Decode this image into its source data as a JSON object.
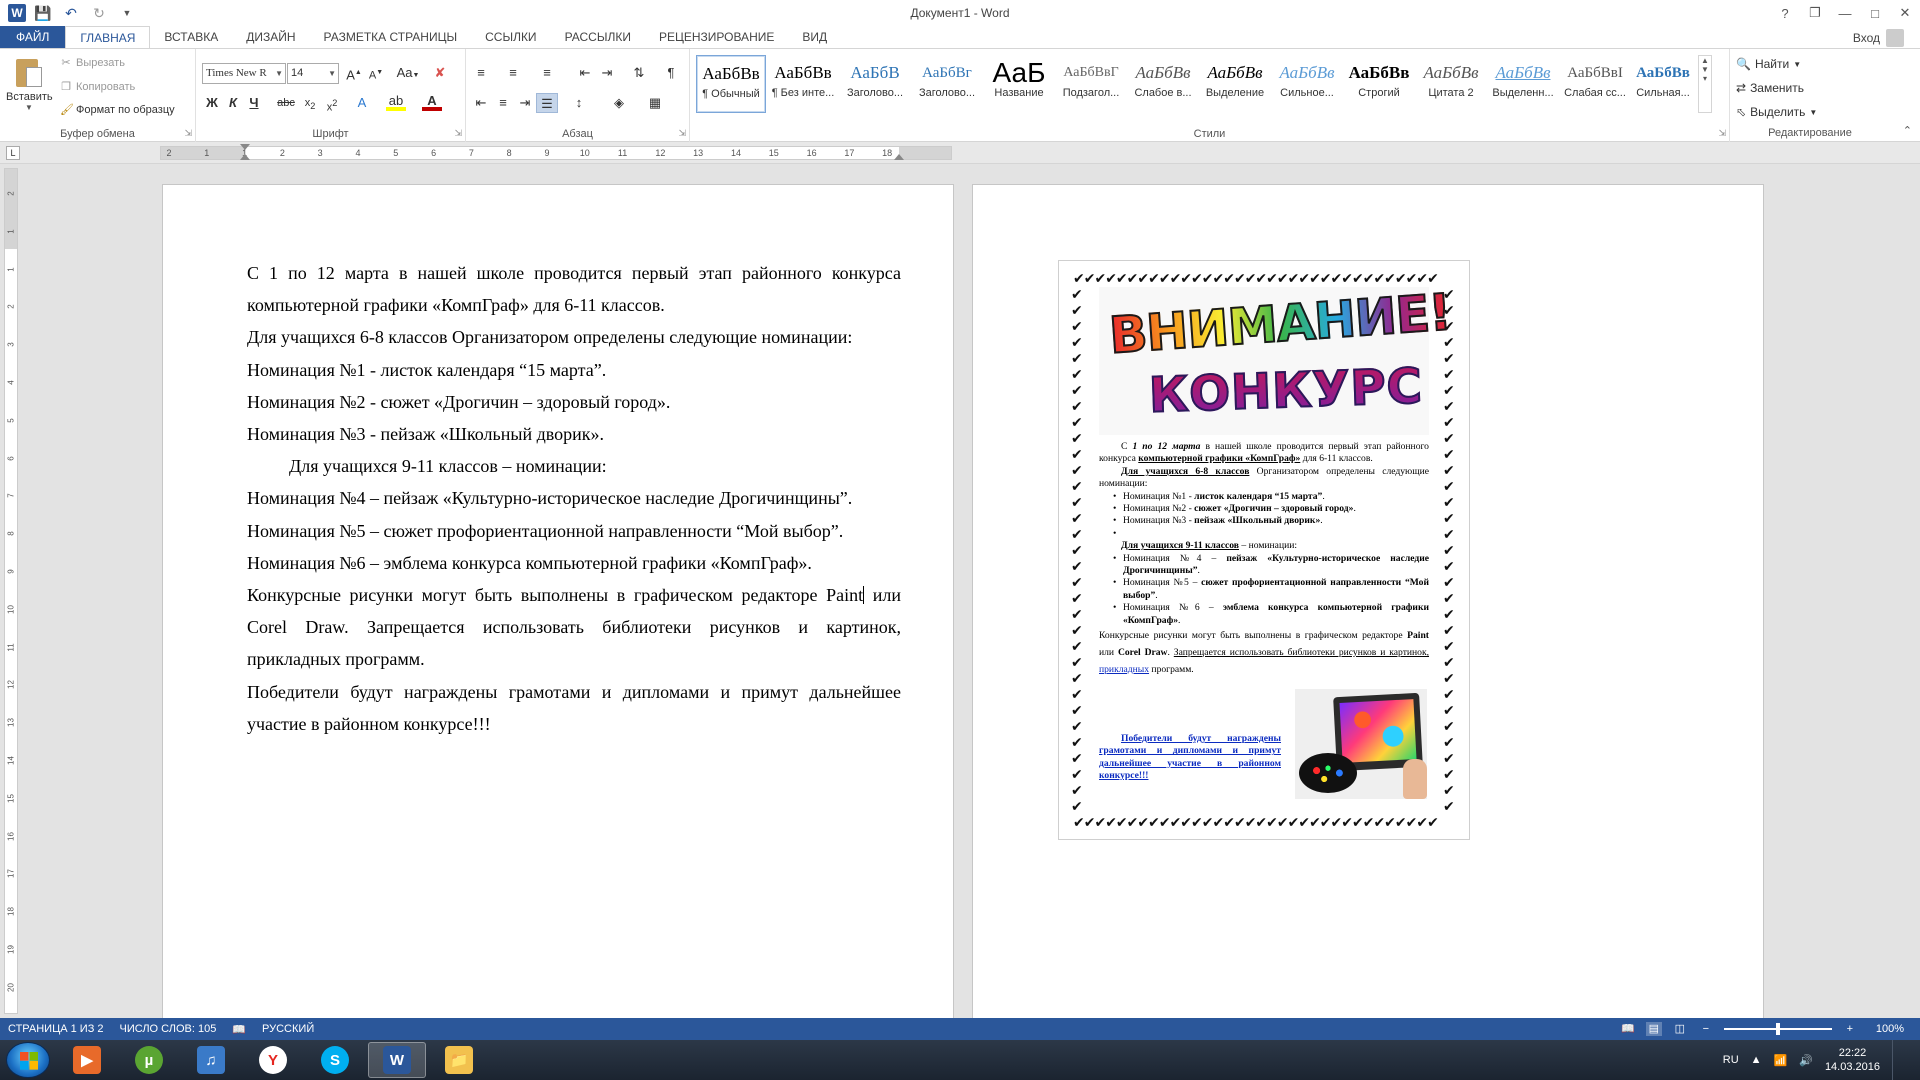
{
  "app": {
    "title": "Документ1 - Word",
    "qat": {
      "undo_icon": "undo-icon",
      "redo_icon": "redo-icon"
    },
    "window_controls": [
      "?",
      "❐",
      "—",
      "□",
      "✕"
    ],
    "sign_in": "Вход"
  },
  "tabs": [
    "ФАЙЛ",
    "ГЛАВНАЯ",
    "ВСТАВКА",
    "ДИЗАЙН",
    "РАЗМЕТКА СТРАНИЦЫ",
    "ССЫЛКИ",
    "РАССЫЛКИ",
    "РЕЦЕНЗИРОВАНИЕ",
    "ВИД"
  ],
  "ribbon": {
    "clipboard": {
      "paste": "Вставить",
      "cut": "Вырезать",
      "copy": "Копировать",
      "format_painter": "Формат по образцу",
      "label": "Буфер обмена"
    },
    "font": {
      "name": "Times New R",
      "size": "14",
      "label": "Шрифт"
    },
    "paragraph": {
      "label": "Абзац"
    },
    "styles": {
      "label": "Стили",
      "items": [
        {
          "sample": "АаБбВв",
          "name": "¶ Обычный"
        },
        {
          "sample": "АаБбВв",
          "name": "¶ Без инте..."
        },
        {
          "sample": "АаБбВ",
          "name": "Заголово..."
        },
        {
          "sample": "АаБбВг",
          "name": "Заголово..."
        },
        {
          "sample": "АаБ",
          "name": "Название"
        },
        {
          "sample": "АаБбВвГ",
          "name": "Подзагол..."
        },
        {
          "sample": "АаБбВв",
          "name": "Слабое в..."
        },
        {
          "sample": "АаБбВв",
          "name": "Выделение"
        },
        {
          "sample": "АаБбВв",
          "name": "Сильное..."
        },
        {
          "sample": "АаБбВв",
          "name": "Строгий"
        },
        {
          "sample": "АаБбВв",
          "name": "Цитата 2"
        },
        {
          "sample": "АаБбВв",
          "name": "Выделенн..."
        },
        {
          "sample": "АаБбВвI",
          "name": "Слабая сс..."
        },
        {
          "sample": "АаБбВв",
          "name": "Сильная..."
        }
      ]
    },
    "editing": {
      "find": "Найти",
      "replace": "Заменить",
      "select": "Выделить",
      "label": "Редактирование"
    }
  },
  "ruler": {
    "tab_selector": "L",
    "numbers": [
      "2",
      "1",
      "1",
      "2",
      "3",
      "4",
      "5",
      "6",
      "7",
      "8",
      "9",
      "10",
      "11",
      "12",
      "13",
      "14",
      "15",
      "16",
      "17",
      "18"
    ],
    "vnumbers": [
      "2",
      "1",
      "1",
      "2",
      "3",
      "4",
      "5",
      "6",
      "7",
      "8",
      "9",
      "10",
      "11",
      "12",
      "13",
      "14",
      "15",
      "16",
      "17",
      "18",
      "19",
      "20"
    ]
  },
  "document": {
    "page1": {
      "p1": "С 1 по 12 марта в нашей школе проводится первый этап районного конкурса компьютерной графики «КомпГраф» для 6-11 классов.",
      "p2": "Для учащихся 6-8 классов Организатором определены следующие номинации:",
      "p3": "Номинация №1 - листок календаря “15 марта”.",
      "p4": "Номинация №2 - сюжет «Дрогичин – здоровый город».",
      "p5": "Номинация №3 - пейзаж «Школьный  дворик».",
      "p6": "Для учащихся 9-11 классов – номинации:",
      "p7": "Номинация №4 – пейзаж «Культурно-историческое наследие Дрогичинщины”.",
      "p8": "Номинация №5 – сюжет профориентационной направленности “Мой выбор”.",
      "p9": "Номинация №6 – эмблема конкурса компьютерной графики «КомпГраф».",
      "p10a": "Конкурсные рисунки могут быть выполнены в графическом редакторе Paint",
      "p10b": " или Corel Draw. Запрещается использовать библиотеки рисунков и картинок, прикладных программ.",
      "p11": "Победители будут награждены грамотами и дипломами и примут дальнейшее участие в районном конкурсе!!!"
    },
    "poster": {
      "title1": "ВНИМАНИЕ!",
      "title2": "КОНКУРС",
      "intro_a": "С ",
      "intro_b": "1 по 12 марта",
      "intro_c": " в нашей школе проводится первый этап районного конкурса ",
      "intro_d": "компьютерной графики «КомпГраф»",
      "intro_e": " для 6-11 классов.",
      "g1_head": "Для учащихся 6-8 классов",
      "g1_rest": " Организатором определены следующие номинации:",
      "n1a": "Номинация №1 - ",
      "n1b": "листок календаря “15 марта”",
      "n2a": "Номинация №2 - ",
      "n2b": "сюжет «Дрогичин – здоровый город»",
      "n3a": "Номинация №3 - ",
      "n3b": "пейзаж «Школьный дворик»",
      "g2_head": "Для учащихся 9-11 классов",
      "g2_rest": " – номинации:",
      "n4a": "Номинация №4 – ",
      "n4b": "пейзаж «Культурно-историческое наследие Дрогичинщины”",
      "n5a": "Номинация №5 – ",
      "n5b": "сюжет профориентационной направленности “Мой выбор”",
      "n6a": "Номинация №6 – ",
      "n6b": "эмблема конкурса компьютерной графики «КомпГраф»",
      "rules_a": "Конкурсные рисунки могут быть выполнены в графическом редакторе ",
      "rules_b": "Paint",
      "rules_c": " или ",
      "rules_d": "Corel Draw",
      "rules_e": ". ",
      "rules_f": "Запрещается использовать библиотеки рисунков и картинок, ",
      "rules_g": "прикладных",
      "rules_h": " программ.",
      "winners": "Победители будут награждены грамотами и дипломами и примут дальнейшее участие в районном конкурсе!!!"
    }
  },
  "status": {
    "page": "СТРАНИЦА 1 ИЗ 2",
    "words": "ЧИСЛО СЛОВ: 105",
    "language": "РУССКИЙ",
    "zoom": "100%",
    "zoom_level": 0.5
  },
  "taskbar": {
    "apps": [
      "media-player-icon",
      "utorrent-icon",
      "audio-icon",
      "yandex-browser-icon",
      "skype-icon",
      "word-icon",
      "explorer-icon"
    ],
    "lang": "RU",
    "time": "22:22",
    "date": "14.03.2016"
  },
  "colors": {
    "accent": "#2b579a",
    "link_blue": "#0b2bc0"
  }
}
